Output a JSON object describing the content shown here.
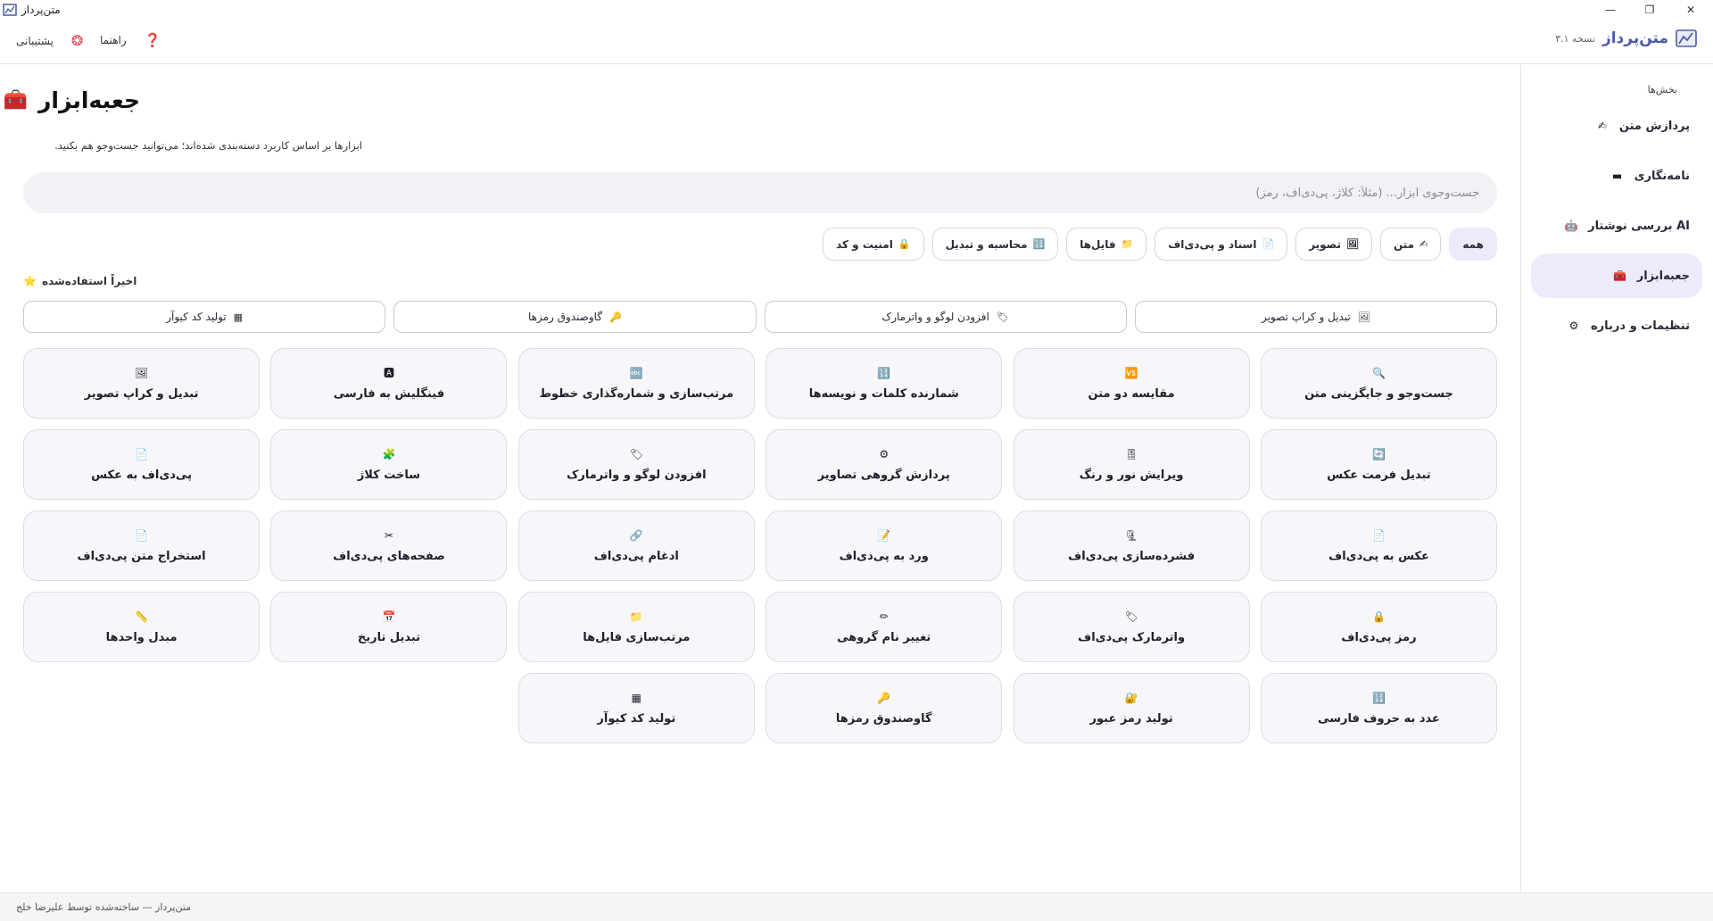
{
  "window": {
    "title": "متن‌پرداز",
    "minimize_glyph": "—",
    "restore_glyph": "❐",
    "close_glyph": "✕"
  },
  "header": {
    "brand_name": "متن‌پرداز",
    "version": "نسخه ۳.۱",
    "support_label": "پشتیبانی",
    "support_icon": "lifebuoy-icon",
    "help_label": "راهنما",
    "help_icon": "question-icon",
    "support_icon_glyph": "❂",
    "help_icon_glyph": "❓"
  },
  "sidebar": {
    "title": "بخش‌ها",
    "items": [
      {
        "label": "پردازش متن",
        "icon": "✍",
        "active": false
      },
      {
        "label": "نامه‌نگاری",
        "icon": "▬",
        "active": false
      },
      {
        "label": "بررسی نوشتار AI",
        "icon": "🤖",
        "active": false
      },
      {
        "label": "جعبه‌ابزار",
        "icon": "🧰",
        "active": true
      },
      {
        "label": "تنظیمات و درباره",
        "icon": "⚙",
        "active": false
      }
    ]
  },
  "main": {
    "title": "جعبه‌ابزار",
    "title_icon": "🧰",
    "subtitle": "ابزارها بر اساس کاربرد دسته‌بندی شده‌اند؛ می‌توانید جست‌وجو هم بکنید.",
    "search_placeholder": "جست‌وجوی ابزار... (مثلاً: کلاژ، پی‌دی‌اف، رمز)",
    "chips": [
      {
        "label": "همه",
        "icon": "",
        "active": true
      },
      {
        "label": "متن",
        "icon": "✍",
        "active": false
      },
      {
        "label": "تصویر",
        "icon": "🖼",
        "active": false
      },
      {
        "label": "اسناد و پی‌دی‌اف",
        "icon": "📄",
        "active": false
      },
      {
        "label": "فایل‌ها",
        "icon": "📁",
        "active": false
      },
      {
        "label": "محاسبه و تبدیل",
        "icon": "🔢",
        "active": false
      },
      {
        "label": "امنیت و کد",
        "icon": "🔒",
        "active": false
      }
    ],
    "recent_label": "اخیراً استفاده‌شده",
    "recent_icon": "⭐",
    "recent": [
      {
        "label": "تبدیل و کراپ تصویر",
        "icon": "🖼"
      },
      {
        "label": "افزودن لوگو و واترمارک",
        "icon": "🏷"
      },
      {
        "label": "گاوصندوق رمزها",
        "icon": "🔑"
      },
      {
        "label": "تولید کد کیوآر",
        "icon": "▦"
      }
    ],
    "tools": [
      {
        "label": "جست‌وجو و جایگزینی متن",
        "icon": "🔍"
      },
      {
        "label": "مقایسه دو متن",
        "icon": "🆚"
      },
      {
        "label": "شمارنده کلمات و نویسه‌ها",
        "icon": "🔢"
      },
      {
        "label": "مرتب‌سازی و شماره‌گذاری خطوط",
        "icon": "🔤"
      },
      {
        "label": "فینگلیش به فارسی",
        "icon": "🅰"
      },
      {
        "label": "تبدیل و کراپ تصویر",
        "icon": "🖼"
      },
      {
        "label": "تبدیل فرمت عکس",
        "icon": "🔄"
      },
      {
        "label": "ویرایش نور و رنگ",
        "icon": "🎚"
      },
      {
        "label": "پردازش گروهی تصاویر",
        "icon": "⚙"
      },
      {
        "label": "افزودن لوگو و واترمارک",
        "icon": "🏷"
      },
      {
        "label": "ساخت کلاژ",
        "icon": "🧩"
      },
      {
        "label": "پی‌دی‌اف به عکس",
        "icon": "📄"
      },
      {
        "label": "عکس به پی‌دی‌اف",
        "icon": "📄"
      },
      {
        "label": "فشرده‌سازی پی‌دی‌اف",
        "icon": "🗜"
      },
      {
        "label": "ورد به پی‌دی‌اف",
        "icon": "📝"
      },
      {
        "label": "ادغام پی‌دی‌اف",
        "icon": "🔗"
      },
      {
        "label": "صفحه‌های پی‌دی‌اف",
        "icon": "✂"
      },
      {
        "label": "استخراج متن پی‌دی‌اف",
        "icon": "📄"
      },
      {
        "label": "رمز پی‌دی‌اف",
        "icon": "🔒"
      },
      {
        "label": "واترمارک پی‌دی‌اف",
        "icon": "🏷"
      },
      {
        "label": "تغییر نام گروهی",
        "icon": "✏"
      },
      {
        "label": "مرتب‌سازی فایل‌ها",
        "icon": "📁"
      },
      {
        "label": "تبدیل تاریخ",
        "icon": "📅"
      },
      {
        "label": "مبدل واحدها",
        "icon": "📏"
      },
      {
        "label": "عدد به حروف فارسی",
        "icon": "🔢"
      },
      {
        "label": "تولید رمز عبور",
        "icon": "🔐"
      },
      {
        "label": "گاوصندوق رمزها",
        "icon": "🔑"
      },
      {
        "label": "تولید کد کیوآر",
        "icon": "▦"
      }
    ]
  },
  "footer": {
    "text": "متن‌پرداز — ساخته‌شده توسط علیرضا خلج"
  }
}
